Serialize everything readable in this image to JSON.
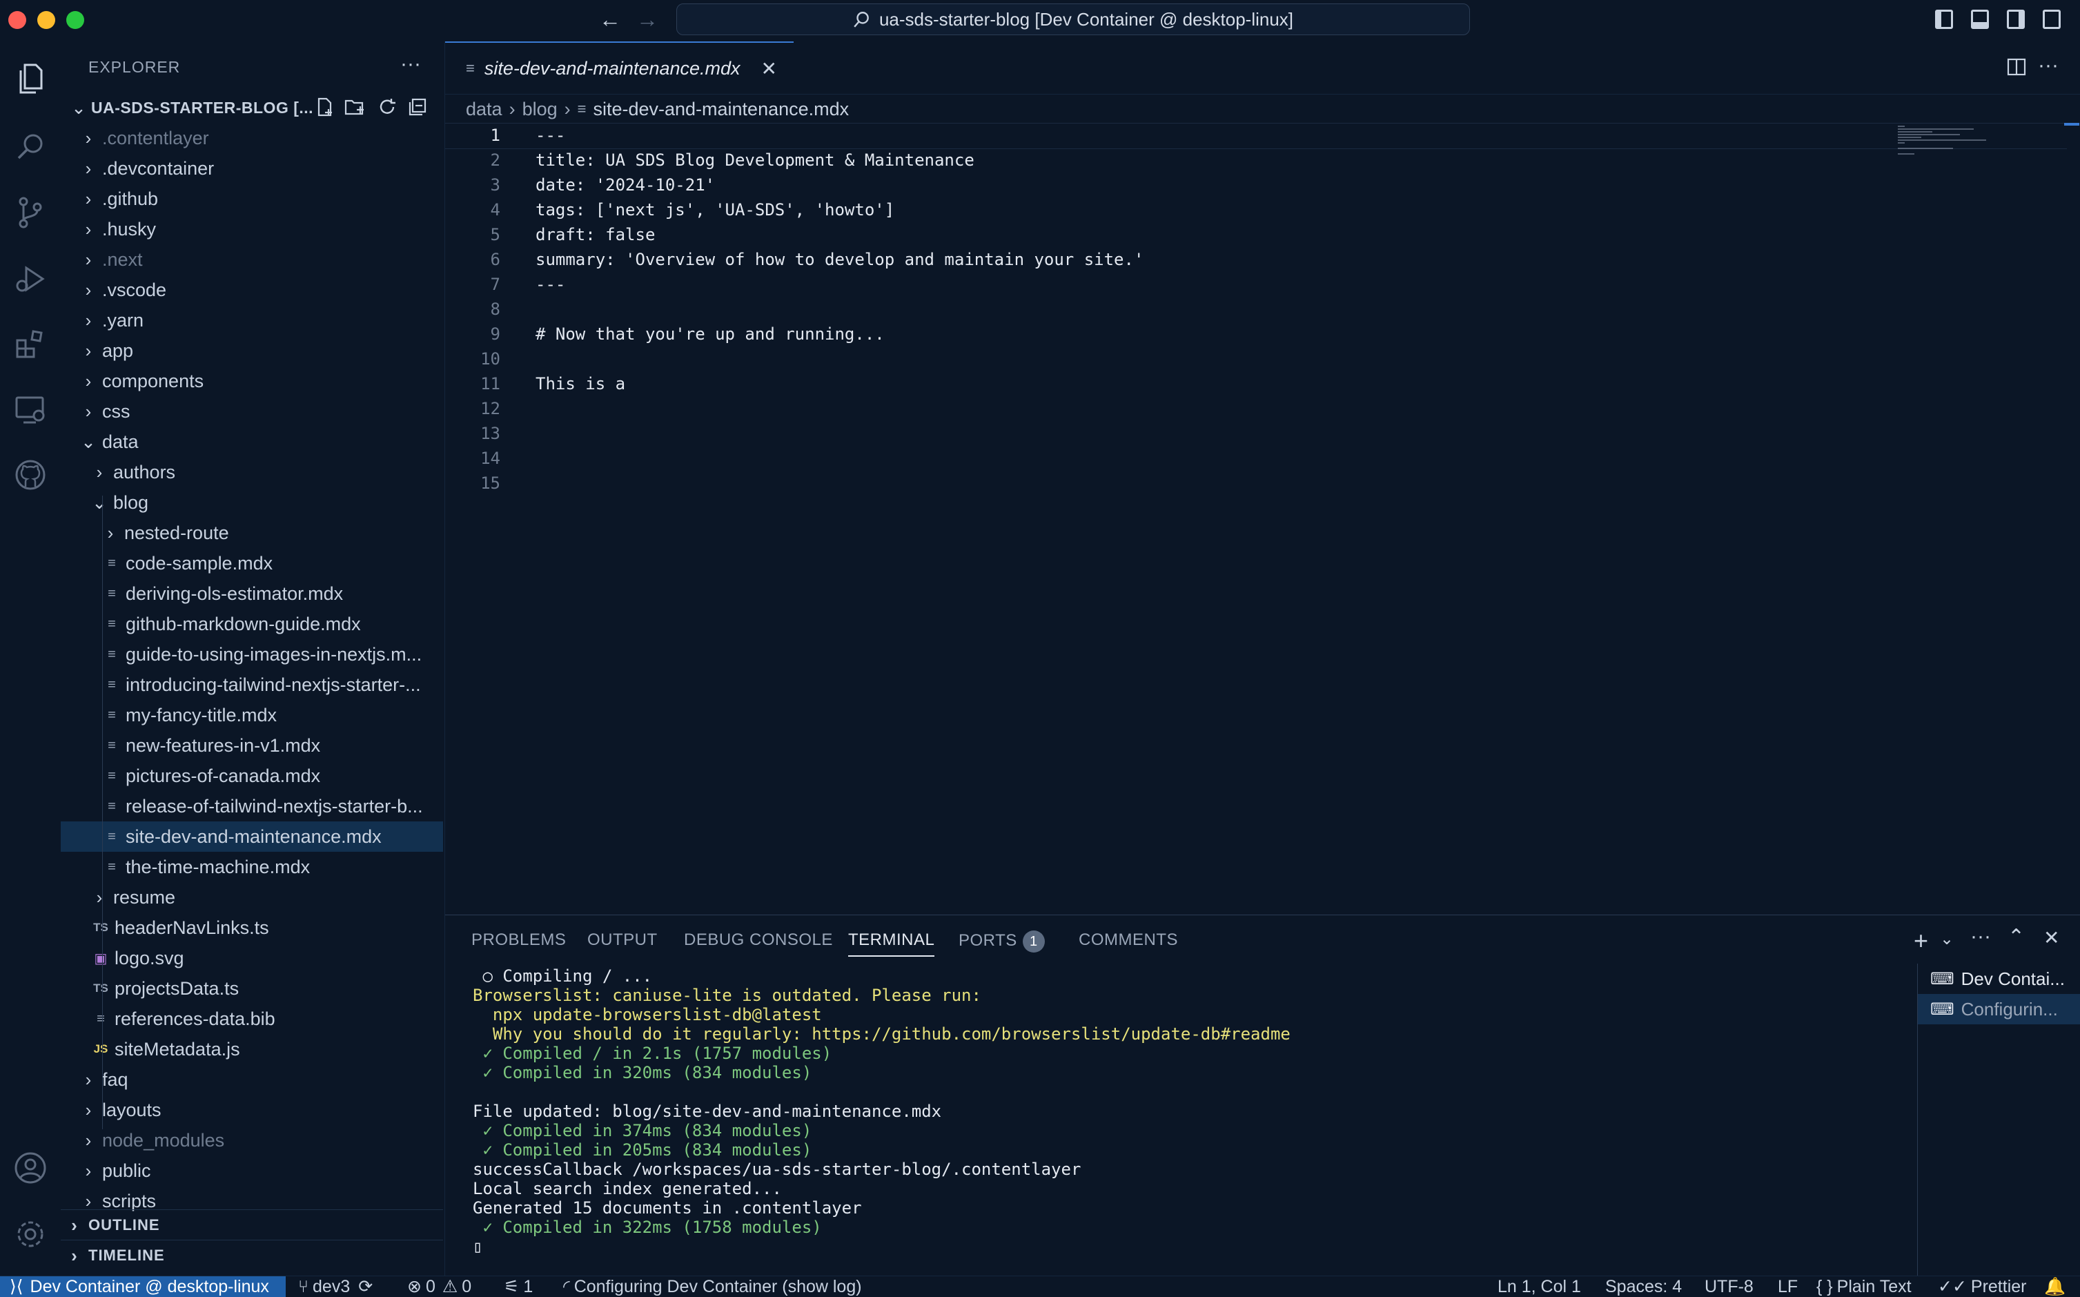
{
  "window": {
    "title": "ua-sds-starter-blog [Dev Container @ desktop-linux]",
    "traffic_colors": [
      "#fe5f57",
      "#febc2e",
      "#28c840"
    ]
  },
  "explorer": {
    "title": "EXPLORER",
    "more_label": "···",
    "root_label": "UA-SDS-STARTER-BLOG [...",
    "rows": [
      {
        "label": ".contentlayer",
        "kind": "folder",
        "depth": 0,
        "open": false,
        "dim": true,
        "icon": ""
      },
      {
        "label": ".devcontainer",
        "kind": "folder",
        "depth": 0,
        "open": false,
        "dim": false,
        "icon": ""
      },
      {
        "label": ".github",
        "kind": "folder",
        "depth": 0,
        "open": false,
        "dim": false,
        "icon": ""
      },
      {
        "label": ".husky",
        "kind": "folder",
        "depth": 0,
        "open": false,
        "dim": false,
        "icon": ""
      },
      {
        "label": ".next",
        "kind": "folder",
        "depth": 0,
        "open": false,
        "dim": true,
        "icon": ""
      },
      {
        "label": ".vscode",
        "kind": "folder",
        "depth": 0,
        "open": false,
        "dim": false,
        "icon": ""
      },
      {
        "label": ".yarn",
        "kind": "folder",
        "depth": 0,
        "open": false,
        "dim": false,
        "icon": ""
      },
      {
        "label": "app",
        "kind": "folder",
        "depth": 0,
        "open": false,
        "dim": false,
        "icon": ""
      },
      {
        "label": "components",
        "kind": "folder",
        "depth": 0,
        "open": false,
        "dim": false,
        "icon": ""
      },
      {
        "label": "css",
        "kind": "folder",
        "depth": 0,
        "open": false,
        "dim": false,
        "icon": ""
      },
      {
        "label": "data",
        "kind": "folder",
        "depth": 0,
        "open": true,
        "dim": false,
        "icon": ""
      },
      {
        "label": "authors",
        "kind": "folder",
        "depth": 1,
        "open": false,
        "dim": false,
        "icon": ""
      },
      {
        "label": "blog",
        "kind": "folder",
        "depth": 1,
        "open": true,
        "dim": false,
        "icon": ""
      },
      {
        "label": "nested-route",
        "kind": "folder",
        "depth": 2,
        "open": false,
        "dim": false,
        "icon": ""
      },
      {
        "label": "code-sample.mdx",
        "kind": "file",
        "depth": 2,
        "dim": false,
        "icon": "≡"
      },
      {
        "label": "deriving-ols-estimator.mdx",
        "kind": "file",
        "depth": 2,
        "dim": false,
        "icon": "≡"
      },
      {
        "label": "github-markdown-guide.mdx",
        "kind": "file",
        "depth": 2,
        "dim": false,
        "icon": "≡"
      },
      {
        "label": "guide-to-using-images-in-nextjs.m...",
        "kind": "file",
        "depth": 2,
        "dim": false,
        "icon": "≡"
      },
      {
        "label": "introducing-tailwind-nextjs-starter-...",
        "kind": "file",
        "depth": 2,
        "dim": false,
        "icon": "≡"
      },
      {
        "label": "my-fancy-title.mdx",
        "kind": "file",
        "depth": 2,
        "dim": false,
        "icon": "≡"
      },
      {
        "label": "new-features-in-v1.mdx",
        "kind": "file",
        "depth": 2,
        "dim": false,
        "icon": "≡"
      },
      {
        "label": "pictures-of-canada.mdx",
        "kind": "file",
        "depth": 2,
        "dim": false,
        "icon": "≡"
      },
      {
        "label": "release-of-tailwind-nextjs-starter-b...",
        "kind": "file",
        "depth": 2,
        "dim": false,
        "icon": "≡"
      },
      {
        "label": "site-dev-and-maintenance.mdx",
        "kind": "file",
        "depth": 2,
        "dim": false,
        "icon": "≡",
        "selected": true
      },
      {
        "label": "the-time-machine.mdx",
        "kind": "file",
        "depth": 2,
        "dim": false,
        "icon": "≡"
      },
      {
        "label": "resume",
        "kind": "folder",
        "depth": 1,
        "open": false,
        "dim": false,
        "icon": ""
      },
      {
        "label": "headerNavLinks.ts",
        "kind": "file",
        "depth": 1,
        "dim": false,
        "icon": "TS"
      },
      {
        "label": "logo.svg",
        "kind": "file",
        "depth": 1,
        "dim": false,
        "icon": "▣"
      },
      {
        "label": "projectsData.ts",
        "kind": "file",
        "depth": 1,
        "dim": false,
        "icon": "TS"
      },
      {
        "label": "references-data.bib",
        "kind": "file",
        "depth": 1,
        "dim": false,
        "icon": "≡"
      },
      {
        "label": "siteMetadata.js",
        "kind": "file",
        "depth": 1,
        "dim": false,
        "icon": "JS"
      },
      {
        "label": "faq",
        "kind": "folder",
        "depth": 0,
        "open": false,
        "dim": false,
        "icon": ""
      },
      {
        "label": "layouts",
        "kind": "folder",
        "depth": 0,
        "open": false,
        "dim": false,
        "icon": ""
      },
      {
        "label": "node_modules",
        "kind": "folder",
        "depth": 0,
        "open": false,
        "dim": true,
        "icon": ""
      },
      {
        "label": "public",
        "kind": "folder",
        "depth": 0,
        "open": false,
        "dim": false,
        "icon": ""
      },
      {
        "label": "scripts",
        "kind": "folder",
        "depth": 0,
        "open": false,
        "dim": false,
        "icon": ""
      }
    ],
    "outline_label": "OUTLINE",
    "timeline_label": "TIMELINE"
  },
  "editor": {
    "tab_label": "site-dev-and-maintenance.mdx",
    "breadcrumb": [
      "data",
      "blog",
      "site-dev-and-maintenance.mdx"
    ],
    "lines": [
      "---",
      "title: UA SDS Blog Development & Maintenance",
      "date: '2024-10-21'",
      "tags: ['next js', 'UA-SDS', 'howto']",
      "draft: false",
      "summary: 'Overview of how to develop and maintain your site.'",
      "---",
      "",
      "# Now that you're up and running...",
      "",
      "This is a",
      "",
      "",
      "",
      ""
    ],
    "current_line": 1
  },
  "panel": {
    "tabs": [
      {
        "label": "PROBLEMS",
        "active": false
      },
      {
        "label": "OUTPUT",
        "active": false
      },
      {
        "label": "DEBUG CONSOLE",
        "active": false
      },
      {
        "label": "TERMINAL",
        "active": true
      },
      {
        "label": "PORTS",
        "active": false,
        "badge": "1"
      },
      {
        "label": "COMMENTS",
        "active": false
      }
    ],
    "terminal_lines": [
      {
        "text": " ○ Compiling / ...",
        "style": ""
      },
      {
        "text": "Browserslist: caniuse-lite is outdated. Please run:",
        "style": "y"
      },
      {
        "text": "  npx update-browserslist-db@latest",
        "style": "y"
      },
      {
        "text": "  Why you should do it regularly: https://github.com/browserslist/update-db#readme",
        "style": "y"
      },
      {
        "text": " ✓ Compiled / in 2.1s (1757 modules)",
        "style": "g"
      },
      {
        "text": " ✓ Compiled in 320ms (834 modules)",
        "style": "g"
      },
      {
        "text": "",
        "style": ""
      },
      {
        "text": "File updated: blog/site-dev-and-maintenance.mdx",
        "style": ""
      },
      {
        "text": " ✓ Compiled in 374ms (834 modules)",
        "style": "g"
      },
      {
        "text": " ✓ Compiled in 205ms (834 modules)",
        "style": "g"
      },
      {
        "text": "successCallback /workspaces/ua-sds-starter-blog/.contentlayer",
        "style": ""
      },
      {
        "text": "Local search index generated...",
        "style": ""
      },
      {
        "text": "Generated 15 documents in .contentlayer",
        "style": ""
      },
      {
        "text": " ✓ Compiled in 322ms (1758 modules)",
        "style": "g"
      },
      {
        "text": "▯",
        "style": ""
      }
    ],
    "terminals": [
      {
        "label": "Dev Contai...",
        "selected": false
      },
      {
        "label": "Configurin...",
        "selected": true
      }
    ]
  },
  "status": {
    "remote": "Dev Container @ desktop-linux",
    "branch": "dev3",
    "errors": "0",
    "warnings": "0",
    "ports": "1",
    "task": "Configuring Dev Container (show log)",
    "position": "Ln 1, Col 1",
    "spaces": "Spaces: 4",
    "encoding": "UTF-8",
    "eol": "LF",
    "language": "Plain Text",
    "formatter": "Prettier"
  }
}
